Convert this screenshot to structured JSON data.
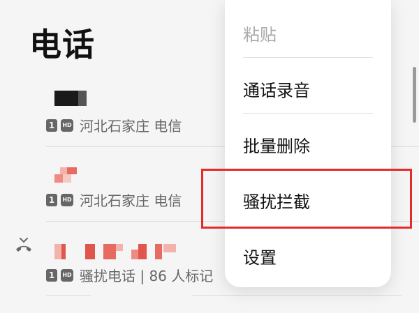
{
  "header": {
    "title": "电话"
  },
  "calls": [
    {
      "sim_badge": "1",
      "hd_badge": "HD",
      "location": "河北石家庄 电信",
      "missed": false
    },
    {
      "sim_badge": "1",
      "hd_badge": "HD",
      "location": "河北石家庄 电信",
      "missed": false
    },
    {
      "sim_badge": "1",
      "hd_badge": "HD",
      "location": "骚扰电话 | 86 人标记",
      "missed": true
    }
  ],
  "menu": {
    "items": [
      {
        "label": "粘贴",
        "enabled": false
      },
      {
        "label": "通话录音",
        "enabled": true
      },
      {
        "label": "批量删除",
        "enabled": true
      },
      {
        "label": "骚扰拦截",
        "enabled": true,
        "highlighted": true
      },
      {
        "label": "设置",
        "enabled": true
      }
    ]
  },
  "colors": {
    "highlight_border": "#e52a2a",
    "redaction_dark": "#222222",
    "redaction_pink": "#ee8c84",
    "redaction_red": "#e0564c"
  }
}
